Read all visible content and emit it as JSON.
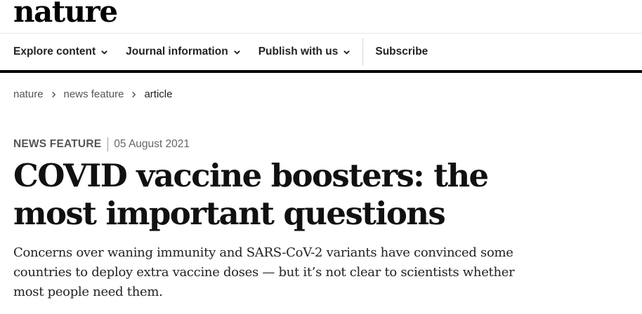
{
  "site": {
    "logo": "nature"
  },
  "nav": {
    "items": [
      {
        "label": "Explore content",
        "has_dropdown": true
      },
      {
        "label": "Journal information",
        "has_dropdown": true
      },
      {
        "label": "Publish with us",
        "has_dropdown": true
      }
    ],
    "subscribe_label": "Subscribe"
  },
  "breadcrumb": [
    "nature",
    "news feature",
    "article"
  ],
  "article": {
    "type": "NEWS FEATURE",
    "date": "05 August 2021",
    "title": "COVID vaccine boosters: the most important questions",
    "standfirst": "Concerns over waning immunity and SARS-CoV-2 variants have convinced some countries to deploy extra vaccine doses — but it’s not clear to scientists whether most people need them."
  },
  "icons": {
    "dropdown": "chevron-down-icon",
    "breadcrumb_separator": "chevron-right-icon"
  },
  "colors": {
    "text": "#222222",
    "muted": "#666666",
    "rule": "#000000"
  }
}
